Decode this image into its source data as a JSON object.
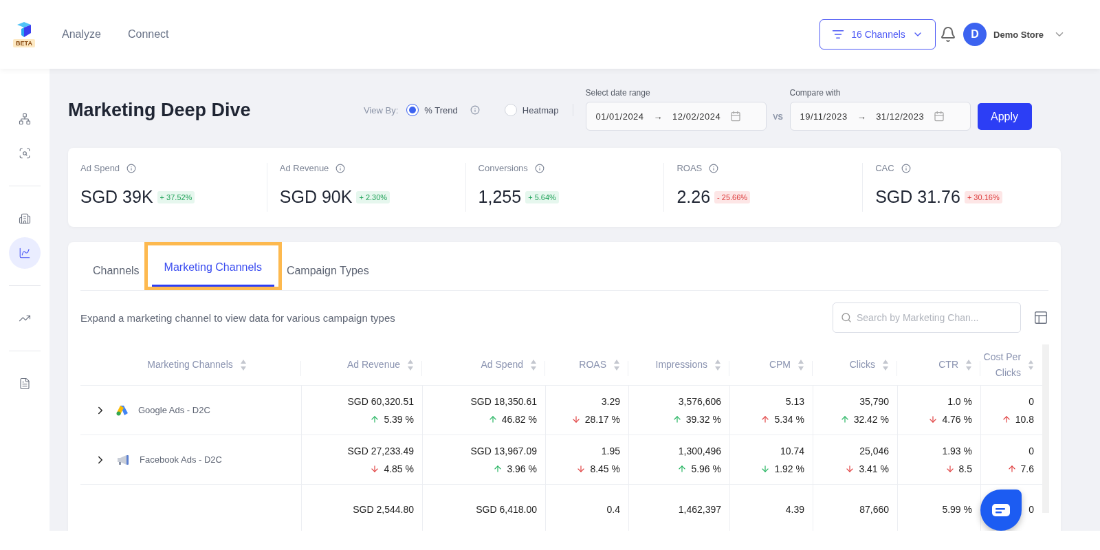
{
  "logo": {
    "badge": "BETA"
  },
  "nav": [
    {
      "label": "Analyze"
    },
    {
      "label": "Connect"
    }
  ],
  "channel_filter": {
    "label": "16 Channels"
  },
  "user": {
    "initial": "D",
    "name": "Demo Store"
  },
  "sidebar": [
    {
      "kind": "icon",
      "selected": false
    },
    {
      "kind": "icon",
      "selected": false
    },
    {
      "kind": "divider"
    },
    {
      "kind": "icon",
      "selected": false
    },
    {
      "kind": "icon",
      "selected": true
    },
    {
      "kind": "divider"
    },
    {
      "kind": "icon",
      "selected": false
    },
    {
      "kind": "divider"
    },
    {
      "kind": "icon",
      "selected": false
    }
  ],
  "page_title": "Marketing Deep Dive",
  "view_by": {
    "label": "View By:",
    "options": [
      {
        "label": "% Trend",
        "selected": true,
        "info": true
      },
      {
        "label": "Heatmap",
        "selected": false,
        "info": false
      }
    ]
  },
  "date_range": {
    "label": "Select date range",
    "from": "01/01/2024",
    "arrow": "→",
    "to": "12/02/2024"
  },
  "vs": "VS",
  "compare": {
    "label": "Compare with",
    "from": "19/11/2023",
    "arrow": "→",
    "to": "31/12/2023"
  },
  "apply": "Apply",
  "kpis": [
    {
      "label": "Ad Spend",
      "value": "SGD 39K",
      "change": "+ 37.52%",
      "good": true
    },
    {
      "label": "Ad Revenue",
      "value": "SGD 90K",
      "change": "+ 2.30%",
      "good": true
    },
    {
      "label": "Conversions",
      "value": "1,255",
      "change": "+ 5.64%",
      "good": true
    },
    {
      "label": "ROAS",
      "value": "2.26",
      "change": "- 25.66%",
      "good": false
    },
    {
      "label": "CAC",
      "value": "SGD 31.76",
      "change": "+ 30.16%",
      "good": false
    }
  ],
  "tabs": [
    {
      "label": "Channels",
      "selected": false,
      "highlighted": false
    },
    {
      "label": "Marketing Channels",
      "selected": true,
      "highlighted": true
    },
    {
      "label": "Campaign Types",
      "selected": false,
      "highlighted": false
    }
  ],
  "hint": "Expand a marketing channel to view data for various campaign types",
  "search": {
    "placeholder": "Search by Marketing Chan..."
  },
  "table": {
    "columns": [
      "Marketing Channels",
      "Ad Revenue",
      "Ad Spend",
      "ROAS",
      "Impressions",
      "CPM",
      "Clicks",
      "CTR",
      "Cost Per Clicks"
    ],
    "rows": [
      {
        "expanded": false,
        "cells": [
          {
            "value": "Google Ads - D2C"
          },
          {
            "value": "SGD 60,320.51",
            "rising": true,
            "good": true,
            "change": "5.39 %"
          },
          {
            "value": "SGD 18,350.61",
            "rising": true,
            "good": true,
            "change": "46.82 %"
          },
          {
            "value": "3.29",
            "rising": false,
            "good": false,
            "change": "28.17 %"
          },
          {
            "value": "3,576,606",
            "rising": true,
            "good": true,
            "change": "39.32 %"
          },
          {
            "value": "5.13",
            "rising": true,
            "good": false,
            "change": "5.34 %"
          },
          {
            "value": "35,790",
            "rising": true,
            "good": true,
            "change": "32.42 %"
          },
          {
            "value": "1.0 %",
            "rising": false,
            "good": false,
            "change": "4.76 %"
          },
          {
            "value": "0",
            "rising": true,
            "good": false,
            "change": "10.8"
          }
        ]
      },
      {
        "expanded": false,
        "cells": [
          {
            "value": "Facebook Ads - D2C"
          },
          {
            "value": "SGD 27,233.49",
            "rising": false,
            "good": false,
            "change": "4.85 %"
          },
          {
            "value": "SGD 13,967.09",
            "rising": true,
            "good": true,
            "change": "3.96 %"
          },
          {
            "value": "1.95",
            "rising": false,
            "good": false,
            "change": "8.45 %"
          },
          {
            "value": "1,300,496",
            "rising": true,
            "good": true,
            "change": "5.96 %"
          },
          {
            "value": "10.74",
            "rising": false,
            "good": true,
            "change": "1.92 %"
          },
          {
            "value": "25,046",
            "rising": false,
            "good": false,
            "change": "3.41 %"
          },
          {
            "value": "1.93 %",
            "rising": false,
            "good": false,
            "change": "8.5"
          },
          {
            "value": "0",
            "rising": true,
            "good": false,
            "change": "7.6"
          }
        ]
      },
      {
        "cells": [
          {},
          {
            "value": "SGD 2,544.80"
          },
          {
            "value": "SGD 6,418.00"
          },
          {
            "value": "0.4"
          },
          {
            "value": "1,462,397"
          },
          {
            "value": "4.39"
          },
          {
            "value": "87,660"
          },
          {
            "value": "5.99 %"
          },
          {
            "value": "0"
          }
        ]
      }
    ]
  }
}
